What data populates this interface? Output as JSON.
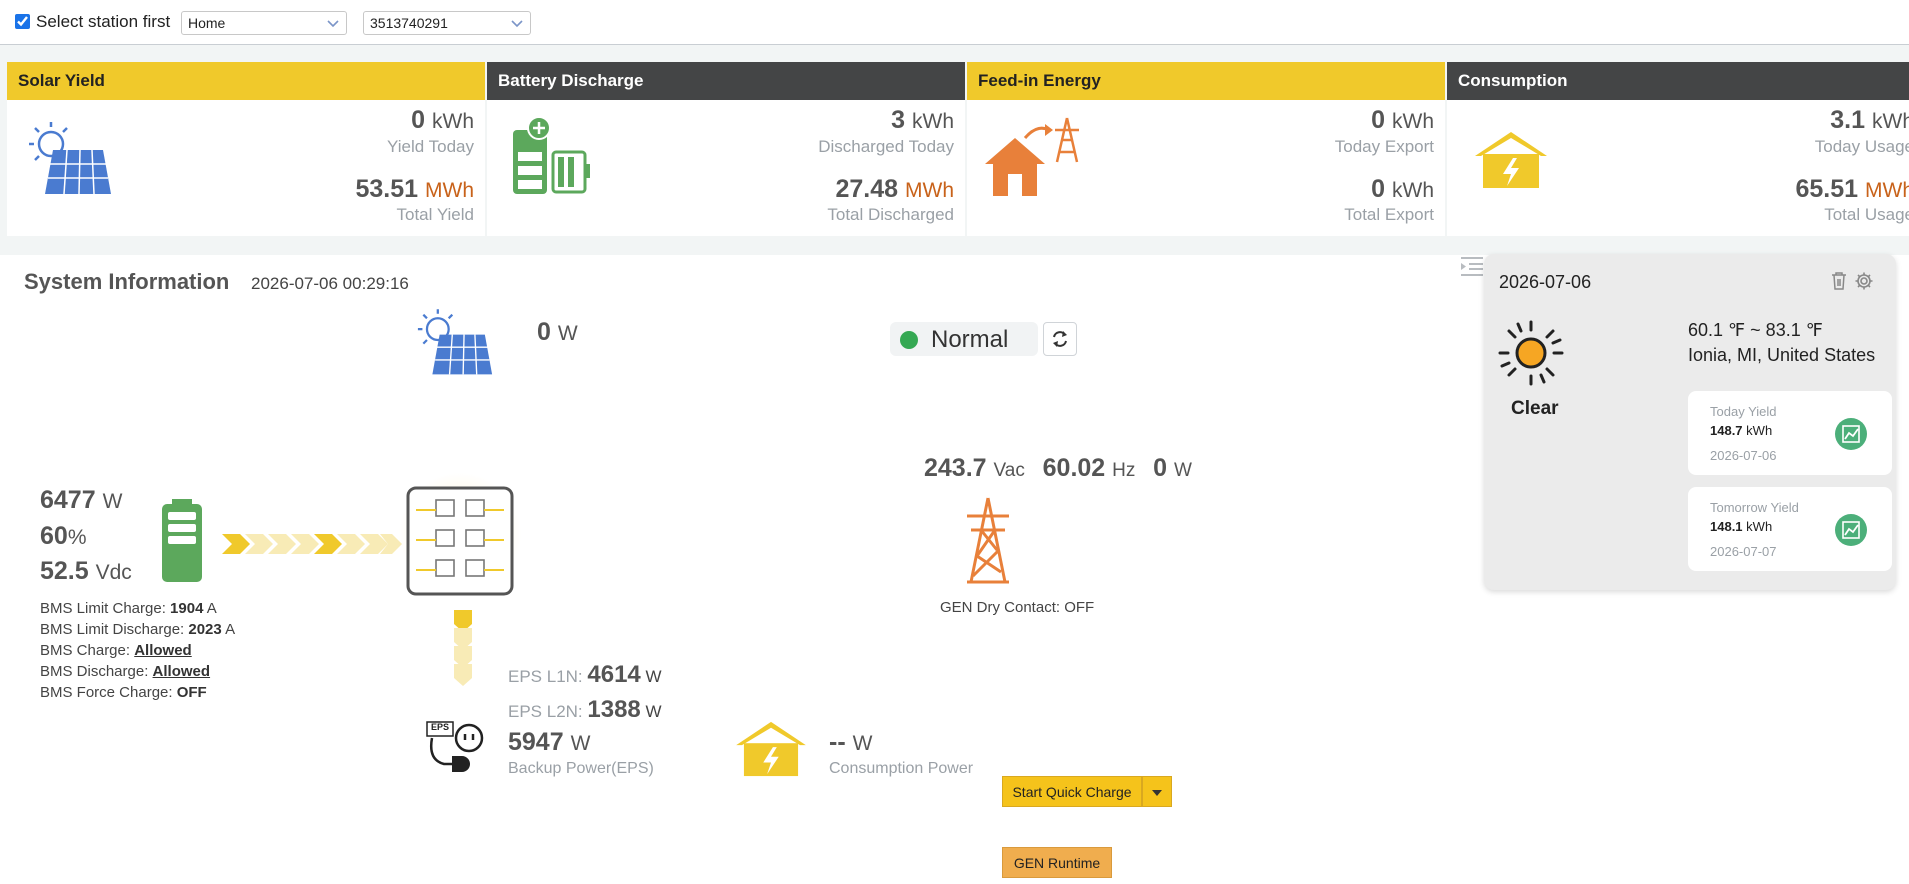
{
  "header": {
    "select_station_checked": true,
    "select_station_label": "Select station first",
    "station_select": "Home",
    "device_select": "3513740291"
  },
  "cards": {
    "solar": {
      "title": "Solar Yield",
      "today_value": "0",
      "today_unit": "kWh",
      "today_label": "Yield Today",
      "total_value": "53.51",
      "total_unit": "MWh",
      "total_label": "Total Yield"
    },
    "battery": {
      "title": "Battery Discharge",
      "today_value": "3",
      "today_unit": "kWh",
      "today_label": "Discharged Today",
      "total_value": "27.48",
      "total_unit": "MWh",
      "total_label": "Total Discharged"
    },
    "feedin": {
      "title": "Feed-in Energy",
      "today_value": "0",
      "today_unit": "kWh",
      "today_label": "Today Export",
      "total_value": "0",
      "total_unit": "kWh",
      "total_label": "Total Export"
    },
    "consumption": {
      "title": "Consumption",
      "today_value": "3.1",
      "today_unit": "kWh",
      "today_label": "Today Usage",
      "total_value": "65.51",
      "total_unit": "MWh",
      "total_label": "Total Usage"
    }
  },
  "system": {
    "title": "System Information",
    "timestamp": "2026-07-06 00:29:16",
    "pv_power": "0",
    "pv_unit": "W",
    "status_text": "Normal",
    "status_color": "#35a853",
    "battery": {
      "power": "6477",
      "power_unit": "W",
      "soc": "60",
      "soc_unit": "%",
      "voltage": "52.5",
      "voltage_unit": "Vdc"
    },
    "bms": {
      "limit_charge_label": "BMS Limit Charge: ",
      "limit_charge_value": "1904",
      "limit_charge_unit": " A",
      "limit_discharge_label": "BMS Limit Discharge: ",
      "limit_discharge_value": "2023",
      "limit_discharge_unit": " A",
      "charge_label": "BMS Charge: ",
      "charge_value": "Allowed",
      "discharge_label": "BMS Discharge: ",
      "discharge_value": "Allowed",
      "force_charge_label": "BMS Force Charge: ",
      "force_charge_value": "OFF"
    },
    "grid": {
      "voltage": "243.7",
      "voltage_unit": "Vac",
      "frequency": "60.02",
      "frequency_unit": "Hz",
      "power": "0",
      "power_unit": "W",
      "gen_label": "GEN Dry Contact: OFF"
    },
    "eps": {
      "l1_label": "EPS L1N:",
      "l1_value": "4614",
      "l1_unit": "W",
      "l2_label": "EPS L2N:",
      "l2_value": "1388",
      "l2_unit": "W",
      "total_value": "5947",
      "total_unit": "W",
      "total_label": "Backup Power(EPS)",
      "badge": "EPS"
    },
    "consumption": {
      "value": "--",
      "unit": "W",
      "label": "Consumption Power"
    },
    "buttons": {
      "quick_charge": "Start Quick Charge",
      "gen_runtime": "GEN Runtime"
    }
  },
  "weather": {
    "date": "2026-07-06",
    "condition": "Clear",
    "temp_range": "60.1 ℉ ~ 83.1 ℉",
    "location": "Ionia, MI, United States",
    "today": {
      "label": "Today Yield",
      "value": "148.7",
      "unit": "kWh",
      "date": "2026-07-06"
    },
    "tomorrow": {
      "label": "Tomorrow Yield",
      "value": "148.1",
      "unit": "kWh",
      "date": "2026-07-07"
    }
  },
  "colors": {
    "accent_yellow": "#f0c92b",
    "header_dark": "#444546",
    "megawatt_orange": "#c8621a",
    "status_green": "#35a853",
    "battery_green": "#5ca85c",
    "grid_orange": "#e8803a"
  }
}
